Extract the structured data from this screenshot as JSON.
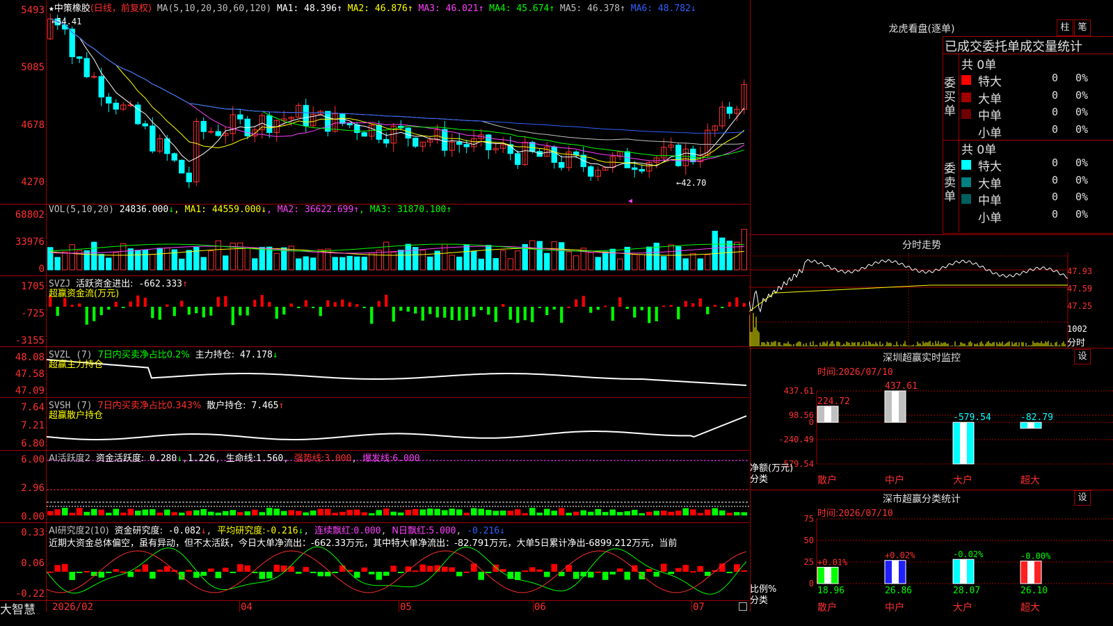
{
  "app_name": "大智慧",
  "stock": {
    "star": "★",
    "name": "中策橡胶",
    "period": "(日线，前复权)"
  },
  "main_panel": {
    "ma_header": {
      "params": "MA(5,10,20,30,60,120)",
      "items": [
        {
          "label": "MA1:",
          "value": "48.396",
          "arrow": "↑",
          "color": "#ffffff"
        },
        {
          "label": "MA2:",
          "value": "46.876",
          "arrow": "↑",
          "color": "#ffff00"
        },
        {
          "label": "MA3:",
          "value": "46.021",
          "arrow": "↑",
          "color": "#ff40ff"
        },
        {
          "label": "MA4:",
          "value": "45.674",
          "arrow": "↑",
          "color": "#00ff00"
        },
        {
          "label": "MA5:",
          "value": "46.378",
          "arrow": "↑",
          "color": "#c0c0c0"
        },
        {
          "label": "MA6:",
          "value": "48.782",
          "arrow": "↓",
          "color": "#3060ff"
        }
      ]
    },
    "y_labels": [
      "5493",
      "5085",
      "4678",
      "4270"
    ],
    "high_annotation": "54.41",
    "low_annotation": "←42.70"
  },
  "vol_panel": {
    "header": {
      "name": "VOL(5,10,20)",
      "value": "24836.000",
      "arrow": "↓",
      "items": [
        {
          "label": "MA1:",
          "value": "44559.000",
          "arrow": "↓",
          "color": "#ffff00"
        },
        {
          "label": "MA2:",
          "value": "36622.699",
          "arrow": "↑",
          "color": "#ff40ff"
        },
        {
          "label": "MA3:",
          "value": "31870.100",
          "arrow": "↑",
          "color": "#00ff00"
        }
      ]
    },
    "y_labels": [
      "68802",
      "33976",
      "0"
    ]
  },
  "svzj_panel": {
    "name": "SVZJ",
    "label": "活跃资金进出:",
    "value": "-662.333",
    "arrow": "↑",
    "sub": "超赢资金流(万元)",
    "y_labels": [
      "1705",
      "-725",
      "-3155"
    ]
  },
  "svzl_panel": {
    "name": "SVZL (7)",
    "desc": "7日内买卖净占比0.2%",
    "label": "主力持仓:",
    "value": "47.178",
    "arrow": "↓",
    "sub": "超赢主力持仓",
    "y_labels": [
      "48.08",
      "47.58",
      "47.09"
    ]
  },
  "svsh_panel": {
    "name": "SVSH (7)",
    "desc": "7日内买卖净占比0.343%",
    "label": "散户持仓:",
    "value": "7.465",
    "arrow": "↑",
    "sub": "超赢散户持仓",
    "y_labels": [
      "7.64",
      "7.21",
      "6.80"
    ]
  },
  "ai_active_panel": {
    "name": "AI活跃度2",
    "label": "资金活跃度:",
    "value": "0.280",
    "value2": "1.226",
    "life_label": "生命线:",
    "life": "1.560",
    "strong_label": "强势线:",
    "strong": "3.000",
    "burst_label": "爆发线:",
    "burst": "6.000",
    "y_labels": [
      "6.00",
      "2.96",
      "0.00"
    ]
  },
  "ai_research_panel": {
    "name": "AI研究度2(10)",
    "label": "资金研究度:",
    "value": "-0.082",
    "avg_label": "平均研究度:",
    "avg": "-0.216",
    "red_label": "连续飘红:",
    "red": "0.000",
    "nred_label": "N日飘红:",
    "nred": "5.000",
    "last": "-0.216",
    "comment": "近期大资金总体偏空，虽有异动，但不太活跃，今日大单净流出：-662.33万元，其中特大单净流出：-82.791万元，大单5日累计净出-6899.212万元，当前",
    "y_labels": [
      "0.33",
      "0.06",
      "-0.22"
    ]
  },
  "x_axis": {
    "labels": [
      "2026/02",
      "04",
      "05",
      "06",
      "07"
    ]
  },
  "dragon_tiger": {
    "title": "龙虎看盘(逐单)",
    "btn1": "柱",
    "btn2": "笔",
    "subtitle": "已成交委托单成交量统计",
    "buy": {
      "side": "委买单",
      "total": "共 0单",
      "rows": [
        {
          "label": "特大",
          "count": "0",
          "pct": "0%",
          "color": "#ff0000"
        },
        {
          "label": "大单",
          "count": "0",
          "pct": "0%",
          "color": "#a00000"
        },
        {
          "label": "中单",
          "count": "0",
          "pct": "0%",
          "color": "#700000"
        },
        {
          "label": "小单",
          "count": "0",
          "pct": "0%",
          "color": "#000000"
        }
      ]
    },
    "sell": {
      "side": "委卖单",
      "total": "共 0单",
      "rows": [
        {
          "label": "特大",
          "count": "0",
          "pct": "0%",
          "color": "#00ffff"
        },
        {
          "label": "大单",
          "count": "0",
          "pct": "0%",
          "color": "#008080"
        },
        {
          "label": "中单",
          "count": "0",
          "pct": "0%",
          "color": "#006060"
        },
        {
          "label": "小单",
          "count": "0",
          "pct": "0%",
          "color": "#000000"
        }
      ]
    }
  },
  "intraday": {
    "title": "分时走势",
    "y_labels": [
      "47.93",
      "47.59",
      "47.25"
    ],
    "vol_label": "1002",
    "vol_sub": "分时"
  },
  "sz_monitor": {
    "title": "深圳超赢实时监控",
    "set": "设",
    "time_label": "时间:",
    "time": "2026/07/10",
    "unit_label": "净额(万元)",
    "unit_sub": "分类",
    "y_labels": [
      "437.61",
      "98.56",
      "0",
      "-240.49",
      "-579.54"
    ],
    "categories": [
      "散户",
      "中户",
      "大户",
      "超大"
    ]
  },
  "sz_class": {
    "title": "深市超赢分类统计",
    "set": "设",
    "time_label": "时间:",
    "time": "2026/07/10",
    "unit_label": "比例%",
    "unit_sub": "分类",
    "y_labels": [
      "75",
      "50",
      "25",
      "0"
    ],
    "categories": [
      "散户",
      "中户",
      "大户",
      "超大"
    ],
    "pct_labels": [
      "+0.01%",
      "+0.02%",
      "-0.02%",
      "-0.00%"
    ],
    "value_labels": [
      "18.96",
      "26.86",
      "28.07",
      "26.10"
    ]
  },
  "chart_data": [
    {
      "type": "bar",
      "title": "深圳超赢实时监控",
      "ylabel": "净额(万元)",
      "categories": [
        "散户",
        "中户",
        "大户",
        "超大"
      ],
      "values": [
        224.72,
        437.61,
        -579.54,
        -82.79
      ],
      "ylim": [
        -579.54,
        437.61
      ]
    },
    {
      "type": "bar",
      "title": "深市超赢分类统计",
      "ylabel": "比例%",
      "categories": [
        "散户",
        "中户",
        "大户",
        "超大"
      ],
      "values": [
        18.96,
        26.86,
        28.07,
        26.1
      ],
      "ylim": [
        0,
        75
      ]
    },
    {
      "type": "line",
      "title": "中策橡胶 日线 均线",
      "series": [
        {
          "name": "MA1",
          "values": [
            48.396
          ]
        },
        {
          "name": "MA2",
          "values": [
            46.876
          ]
        },
        {
          "name": "MA3",
          "values": [
            46.021
          ]
        },
        {
          "name": "MA4",
          "values": [
            45.674
          ]
        },
        {
          "name": "MA5",
          "values": [
            46.378
          ]
        },
        {
          "name": "MA6",
          "values": [
            48.782
          ]
        }
      ],
      "ylim": [
        42.7,
        54.93
      ]
    }
  ],
  "colors": {
    "up": "#ff3030",
    "down": "#00ffff",
    "border": "#a00000",
    "ma1": "#ffffff",
    "ma2": "#ffff00",
    "ma3": "#ff40ff",
    "ma4": "#00ff00",
    "ma5": "#c0c0c0",
    "ma6": "#3060ff"
  }
}
